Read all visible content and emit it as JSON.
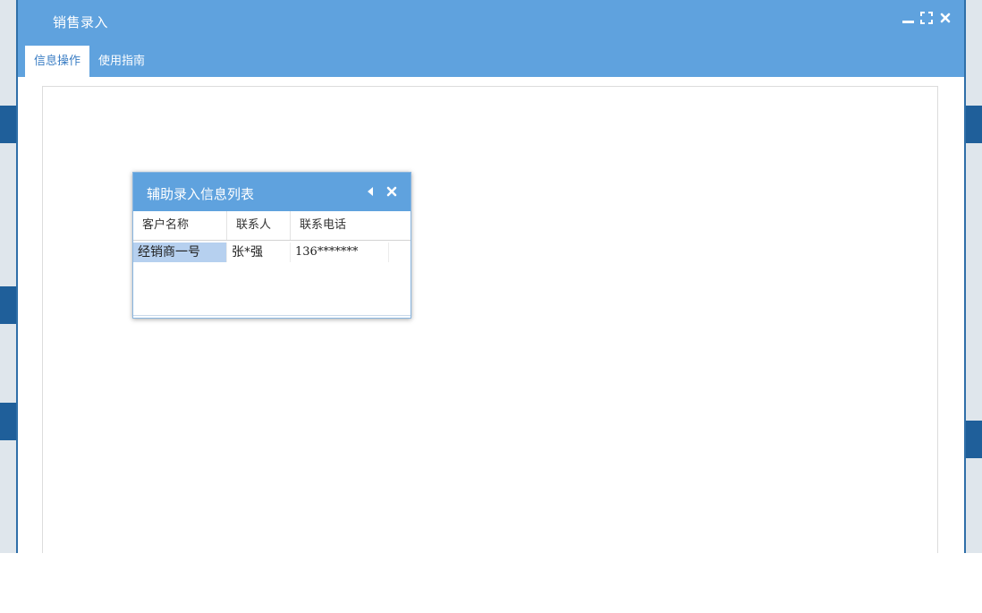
{
  "window": {
    "title": "销售录入",
    "controls": [
      "minimize-icon",
      "maximize-icon",
      "close-icon"
    ]
  },
  "tabs": [
    {
      "label": "信息操作",
      "active": true
    },
    {
      "label": "使用指南",
      "active": false
    }
  ],
  "popup": {
    "title": "辅助录入信息列表",
    "controls": [
      "collapse-left-icon",
      "close-icon"
    ],
    "columns": [
      "客户名称",
      "联系人",
      "联系电话"
    ],
    "rows": [
      [
        "经销商一号",
        "张*强",
        "136*******"
      ]
    ]
  },
  "colors": {
    "header_blue": "#5fa2de",
    "selected_cell": "#b6d0ef",
    "active_tab_text": "#3a7dc4"
  }
}
